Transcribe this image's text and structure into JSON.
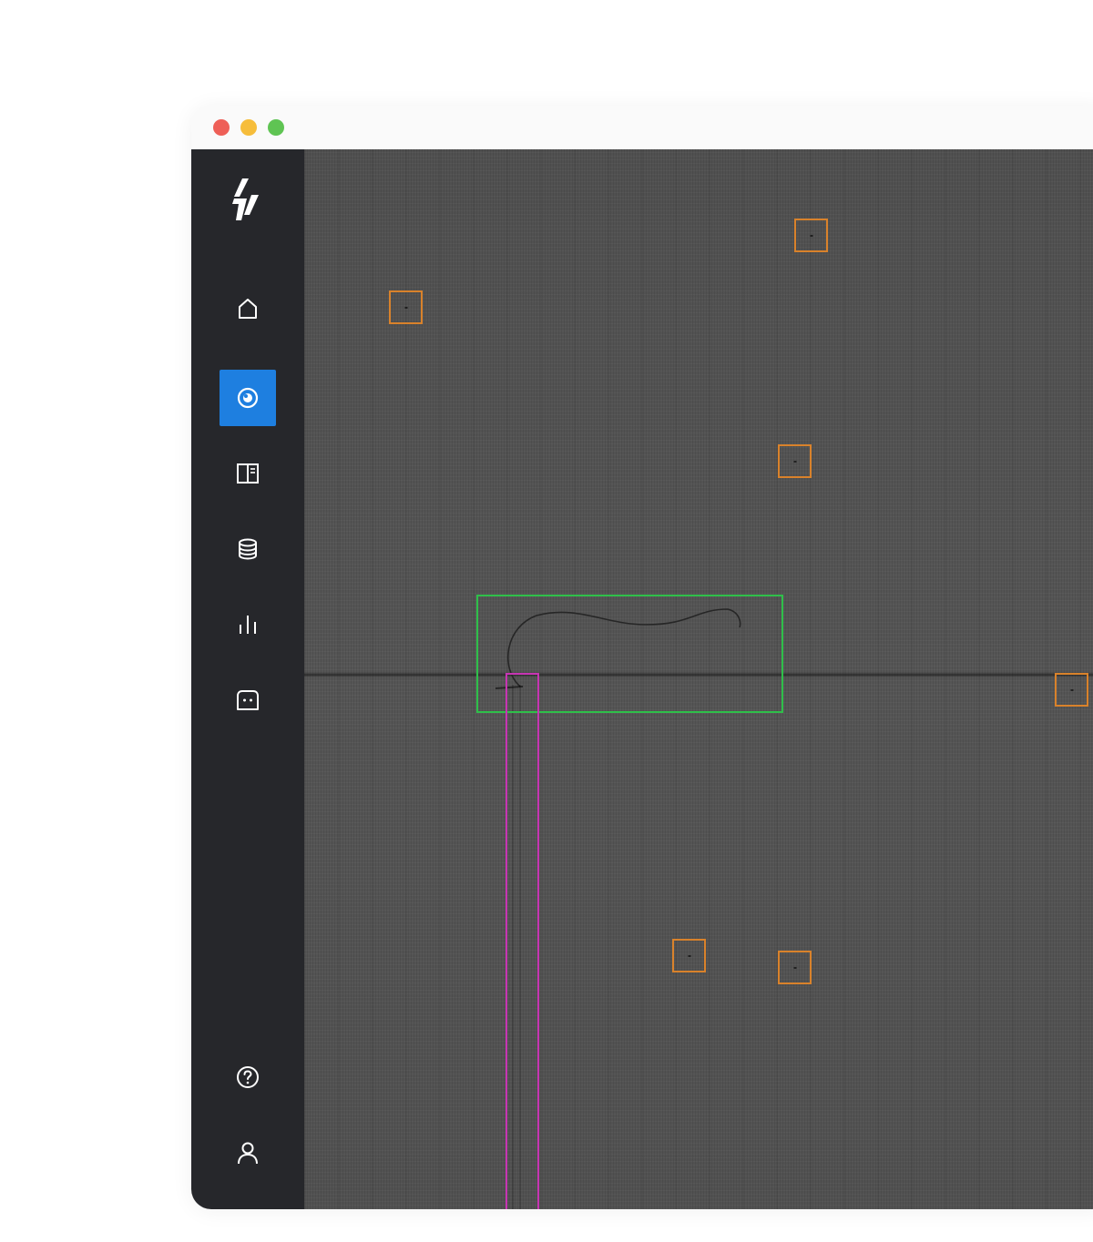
{
  "window": {
    "controls": [
      {
        "name": "close",
        "color": "#ee5f57"
      },
      {
        "name": "minimize",
        "color": "#f6bd3b"
      },
      {
        "name": "maximize",
        "color": "#5fc453"
      }
    ]
  },
  "sidebar": {
    "background": "#26272b",
    "accent": "#1e7fe0",
    "logo_icon": "lightning-slash-logo",
    "items": [
      {
        "id": "home",
        "icon": "home-icon",
        "active": false
      },
      {
        "id": "inspection",
        "icon": "eye-icon",
        "active": true
      },
      {
        "id": "layout",
        "icon": "panel-layout-icon",
        "active": false
      },
      {
        "id": "data",
        "icon": "database-icon",
        "active": false
      },
      {
        "id": "analytics",
        "icon": "bar-chart-icon",
        "active": false
      },
      {
        "id": "assistant",
        "icon": "chat-bot-icon",
        "active": false
      }
    ],
    "bottom_items": [
      {
        "id": "help",
        "icon": "help-circle-icon"
      },
      {
        "id": "account",
        "icon": "user-icon"
      }
    ]
  },
  "viewer": {
    "image": "fabric-texture-grayscale",
    "detection_colors": {
      "spot": "#d9822b",
      "hair": "#2fbf4a",
      "line": "#c735b3"
    }
  }
}
